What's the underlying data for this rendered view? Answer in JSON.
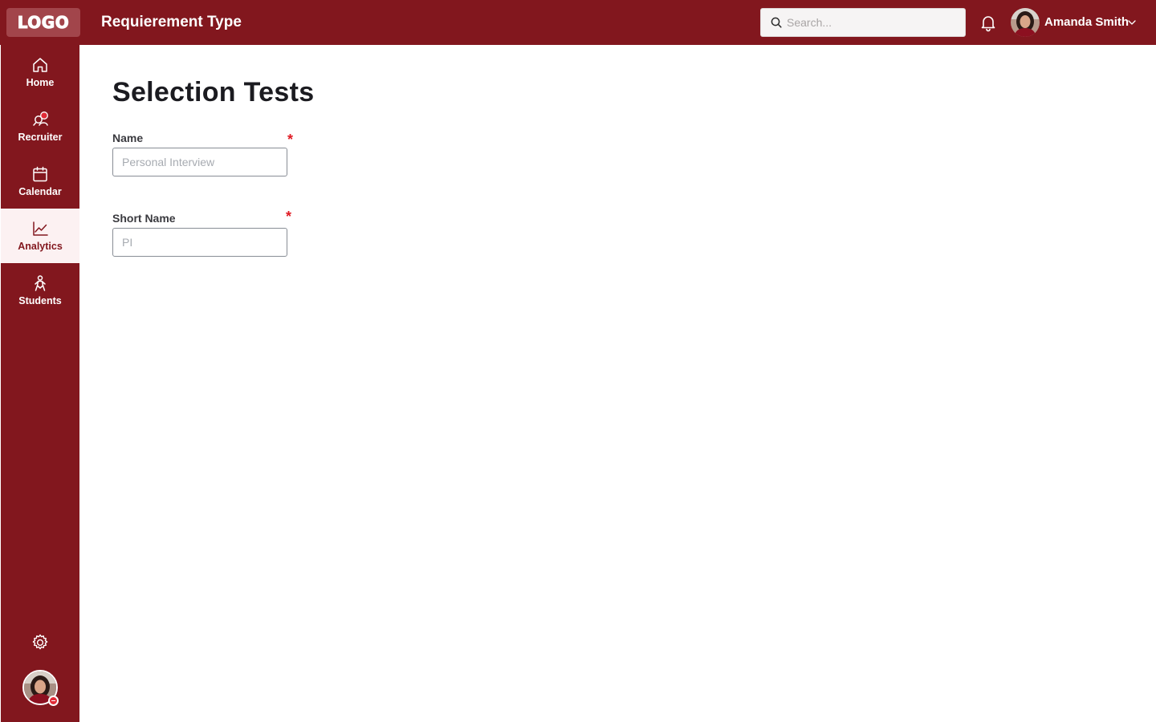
{
  "header": {
    "logo_text": "LOGO",
    "app_title": "Requierement Type",
    "search_placeholder": "Search...",
    "user_name": "Amanda Smith"
  },
  "sidebar": {
    "items": [
      {
        "label": "Home",
        "icon": "home-icon"
      },
      {
        "label": "Recruiter",
        "icon": "recruiter-icon"
      },
      {
        "label": "Calendar",
        "icon": "calendar-icon"
      },
      {
        "label": "Analytics",
        "icon": "analytics-icon",
        "active": true
      },
      {
        "label": "Students",
        "icon": "students-icon"
      }
    ],
    "settings_icon": "gear-icon"
  },
  "main": {
    "title": "Selection Tests",
    "fields": [
      {
        "label": "Name",
        "placeholder": "Personal Interview",
        "required_mark": "*"
      },
      {
        "label": "Short Name",
        "placeholder": "PI",
        "required_mark": "*"
      }
    ]
  },
  "colors": {
    "brand": "#82171e",
    "active_bg": "#fcf1f2",
    "required": "#e01b24"
  }
}
